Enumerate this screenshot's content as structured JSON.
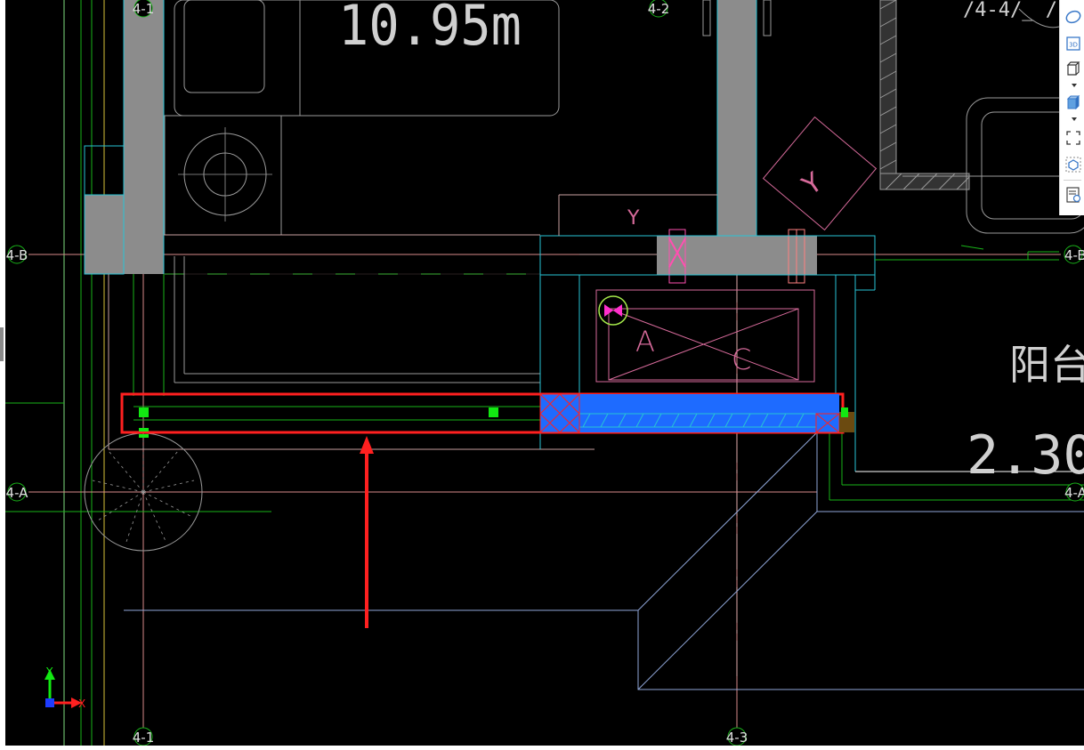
{
  "drawing": {
    "area_label": "10.95m",
    "balcony_label": "阳台",
    "balcony_area_partial": "2.30m",
    "room_label_partial": "/4-4/_ /"
  },
  "grid_labels": {
    "top_4_1": "4-1",
    "top_4_2": "4-2",
    "left_4_b": "4-B",
    "right_4_b": "4-B",
    "left_4_a": "4-A",
    "right_4_a": "4-A",
    "bottom_4_1": "4-1",
    "bottom_4_3": "4-3"
  },
  "equipment": {
    "label_a": "A",
    "label_c": "C",
    "label_y": "Y"
  },
  "ucs": {
    "x_label": "X",
    "y_label": "Y"
  },
  "toolbar": {
    "buttons": [
      "orbit-icon",
      "3d-view-icon",
      "view-cube-icon",
      "shaded-cube-icon",
      "selection-frame-icon",
      "isolate-object-icon",
      "properties-icon"
    ],
    "view_3d_text": "3D"
  },
  "colors": {
    "background": "#000000",
    "wall_fill": "#8c8c8c",
    "selected_beam": "#1e6bff",
    "highlight": "#ff2020",
    "grid_line": "#d98a8a",
    "cyan_outline": "#27c3d6",
    "green_line": "#19b419",
    "grip": "#12e812"
  }
}
